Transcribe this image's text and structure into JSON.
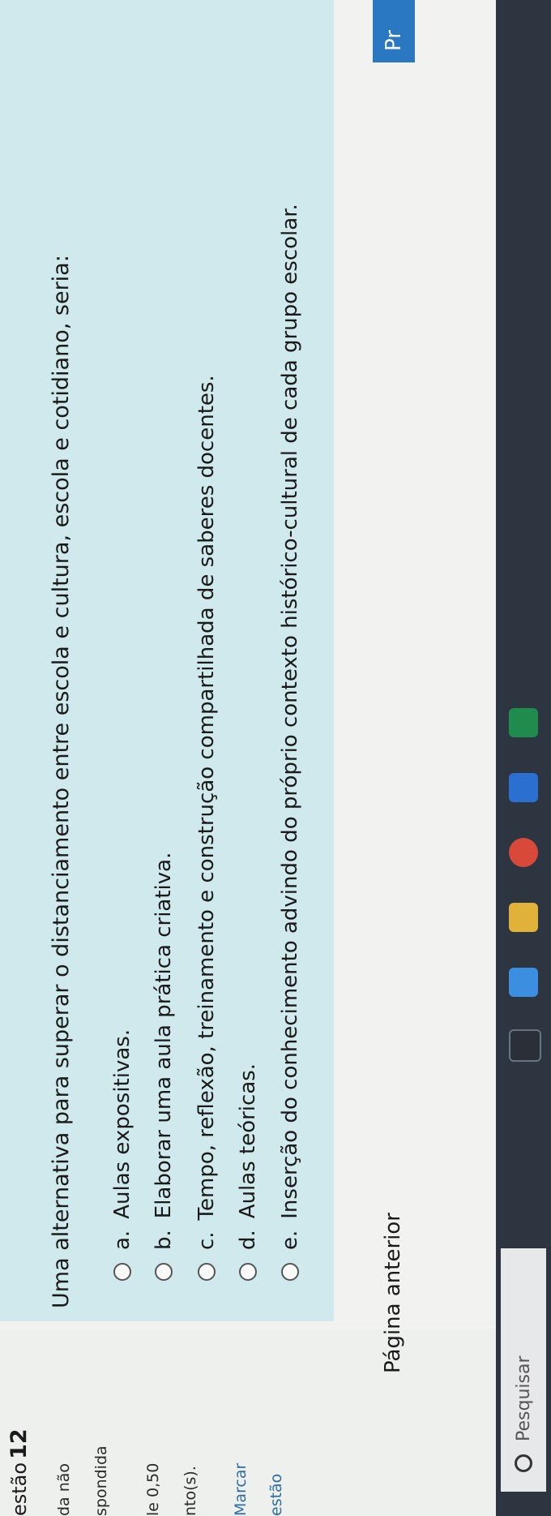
{
  "sidebar": {
    "question_prefix": "estão",
    "question_number": "12",
    "status_line1": "da não",
    "status_line2": "spondida",
    "grade_line1": "le 0,50",
    "grade_line2": "nto(s).",
    "flag_line1": "Marcar",
    "flag_line2": "estão"
  },
  "question": {
    "text": "Uma alternativa para superar o distanciamento entre escola e cultura, escola e cotidiano, seria:",
    "options": [
      {
        "letter": "a.",
        "text": "Aulas expositivas."
      },
      {
        "letter": "b.",
        "text": "Elaborar uma aula prática criativa."
      },
      {
        "letter": "c.",
        "text": "Tempo, reflexão, treinamento e construção compartilhada de saberes docentes."
      },
      {
        "letter": "d.",
        "text": "Aulas teóricas."
      },
      {
        "letter": "e.",
        "text": "Inserção do conhecimento advindo do próprio contexto histórico-cultural de cada grupo escolar."
      }
    ]
  },
  "navigation": {
    "prev_label": "Página anterior",
    "next_label": "Pr"
  },
  "taskbar": {
    "search_placeholder": "Pesquisar"
  },
  "colors": {
    "question_bg": "#cfe9ec",
    "next_button": "#2a78c2",
    "flag_text": "#2f6f9f",
    "taskbar": "#2d3540"
  }
}
